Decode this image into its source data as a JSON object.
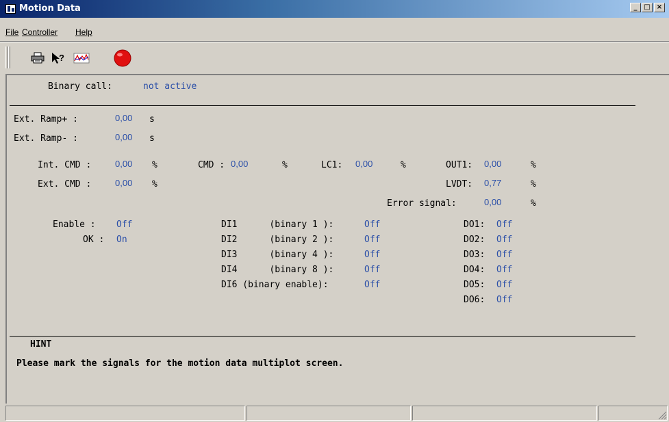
{
  "window": {
    "title": "Motion Data",
    "minimize": "_",
    "maximize": "□",
    "close": "×"
  },
  "menu": [
    "File",
    "Controller",
    "Help"
  ],
  "toolbar": [
    "printer-icon",
    "help-pointer-icon",
    "chart-icon",
    "record-icon"
  ],
  "binary_call": {
    "label": "Binary call:",
    "value": "not active"
  },
  "ramps": [
    {
      "label": "Ext. Ramp+ :",
      "value": "0,00",
      "unit": "s"
    },
    {
      "label": "Ext. Ramp- :",
      "value": "0,00",
      "unit": "s"
    }
  ],
  "cmd": {
    "int_cmd": {
      "label": "Int. CMD :",
      "value": "0,00",
      "unit": "%"
    },
    "ext_cmd": {
      "label": "Ext. CMD :",
      "value": "0,00",
      "unit": "%"
    },
    "cmd": {
      "label": "CMD :",
      "value": "0,00",
      "unit": "%"
    },
    "lc1": {
      "label": "LC1:",
      "value": "0,00",
      "unit": "%"
    },
    "out1": {
      "label": "OUT1:",
      "value": "0,00",
      "unit": "%"
    },
    "lvdt": {
      "label": "LVDT:",
      "value": "0,77",
      "unit": "%"
    },
    "error": {
      "label": "Error signal:",
      "value": "0,00",
      "unit": "%"
    }
  },
  "status_left": [
    {
      "label": "Enable :",
      "value": "Off"
    },
    {
      "label": "OK :",
      "value": "On"
    }
  ],
  "digital_inputs": [
    {
      "label": "DI1      (binary 1 ):",
      "value": "Off"
    },
    {
      "label": "DI2      (binary 2 ):",
      "value": "Off"
    },
    {
      "label": "DI3      (binary 4 ):",
      "value": "Off"
    },
    {
      "label": "DI4      (binary 8 ):",
      "value": "Off"
    },
    {
      "label": "DI6 (binary enable):",
      "value": "Off"
    }
  ],
  "digital_outputs": [
    {
      "label": "DO1:",
      "value": "Off"
    },
    {
      "label": "DO2:",
      "value": "Off"
    },
    {
      "label": "DO3:",
      "value": "Off"
    },
    {
      "label": "DO4:",
      "value": "Off"
    },
    {
      "label": "DO5:",
      "value": "Off"
    },
    {
      "label": "DO6:",
      "value": "Off"
    }
  ],
  "hint": {
    "title": "HINT",
    "text": "Please mark the signals for the motion data multiplot screen."
  }
}
